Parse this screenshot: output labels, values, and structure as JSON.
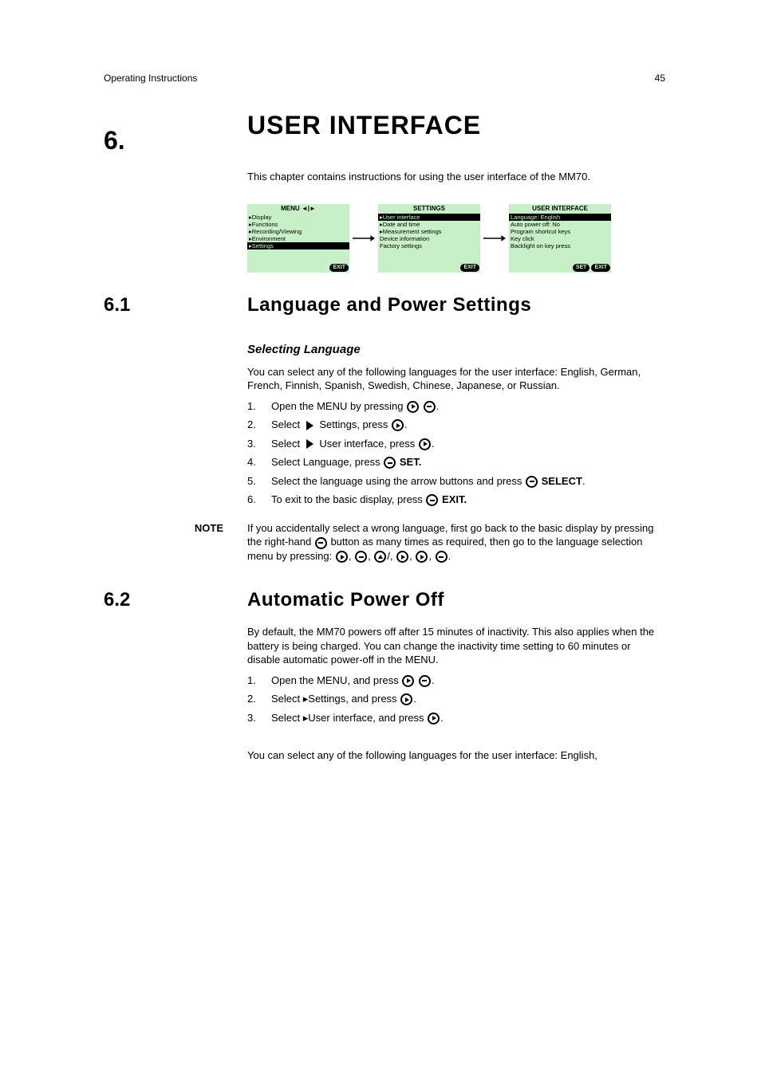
{
  "header": {
    "doc_title": "Operating Instructions",
    "page_num": "45"
  },
  "chapter": {
    "num": "6.",
    "title": "USER INTERFACE"
  },
  "intro": "This chapter contains instructions for using the user interface of the MM70.",
  "screens": {
    "menu": {
      "title": "MENU ◄|►",
      "items": [
        "▸Display",
        "▸Functions",
        "▸Recording/Viewing",
        "▸Environment",
        "▸Settings"
      ],
      "selected": 4,
      "buttons": [
        "EXIT"
      ]
    },
    "settings": {
      "title": "SETTINGS",
      "items": [
        "▸User interface",
        "▸Date and time",
        "▸Measurement settings",
        "Device information",
        "Factory settings"
      ],
      "selected": 0,
      "buttons": [
        "EXIT"
      ]
    },
    "ui": {
      "title": "USER INTERFACE",
      "items": [
        "Language: English",
        "Auto power off: No",
        "Program shortcut keys",
        "Key click",
        "Backlight on key press"
      ],
      "selected": 0,
      "buttons": [
        "SET",
        "EXIT"
      ]
    }
  },
  "sub1": {
    "num": "6.1",
    "title": "Language and Power Settings"
  },
  "lang": {
    "heading": "Selecting Language",
    "intro": "You can select any of the following languages for the user interface: English, German, French, Finnish, Spanish, Swedish, Chinese, Japanese, or Russian.",
    "steps": [
      "Open the MENU by pressing",
      "Select   Settings, press",
      "Select   User interface, press",
      "Select Language, press",
      "Select the language using the",
      "To exit to the basic display, press"
    ],
    "step4_tail": "SET.",
    "step5_tail": "arrow buttons and press  SELECT.",
    "step6_tail": "EXIT.",
    "note_label": "NOTE",
    "note_text": "If you accidentally select a wrong language, first go back to the basic display by pressing the right-hand   button as many times as required, then go to the language selection menu by pressing: , , / , , , ."
  },
  "sub2": {
    "num": "6.2",
    "title": "Automatic Power Off"
  },
  "apo": {
    "p1": "By default, the MM70 powers off after 15 minutes of inactivity. This also applies when the battery is being charged. You can change the inactivity time setting to 60 minutes or disable automatic power-off in the MENU.",
    "steps": [
      "Open the MENU, and press",
      "Select ▸Settings, and press",
      "Select ▸User interface, and press"
    ],
    "foot": "You can select any of the following languages for the user interface: English,"
  }
}
